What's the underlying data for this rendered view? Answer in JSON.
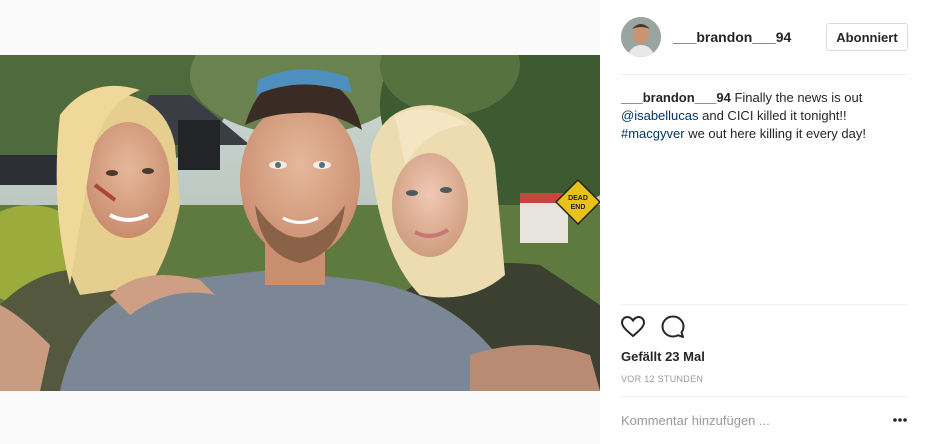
{
  "post": {
    "username": "___brandon___94",
    "follow_button": "Abonniert",
    "caption": {
      "username": "___brandon___94",
      "text_1": " Finally the news is out ",
      "mention": "@isabellucas",
      "text_2": " and CICI killed it tonight!! ",
      "hashtag": "#macgyver",
      "text_3": " we out here killing it every day!"
    },
    "likes": "Gefällt 23 Mal",
    "timestamp": "VOR 12 STUNDEN",
    "comment_placeholder": "Kommentar hinzufügen ..."
  },
  "photo": {
    "sign_text": "DEAD END"
  },
  "icons": {
    "like": "heart-icon",
    "comment": "speech-bubble-icon",
    "more": "ellipsis-icon"
  },
  "colors": {
    "link": "#003569",
    "muted": "#999999",
    "border": "#dbdbdb",
    "sign": "#e8c21a"
  }
}
